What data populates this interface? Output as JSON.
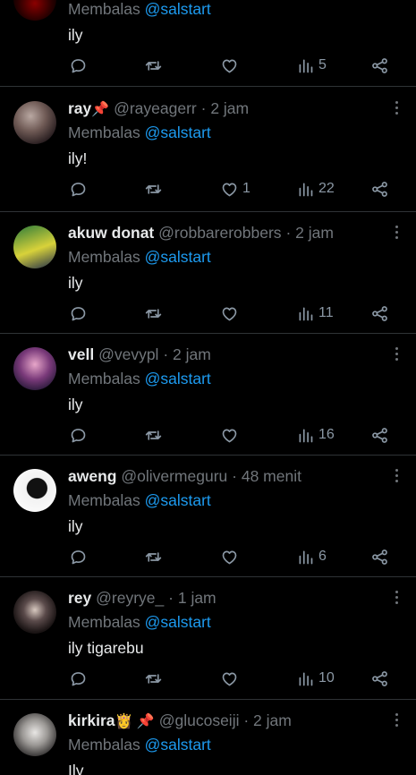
{
  "reply_prefix": "Membalas",
  "mention": "@salstart",
  "tweets": [
    {
      "name": "",
      "handle": "",
      "time": "",
      "text": "ily",
      "likes": "",
      "views": "5"
    },
    {
      "name": "ray",
      "name_emoji": "📌",
      "handle": "@rayeagerr",
      "time": "· 2 jam",
      "text": "ily!",
      "likes": "1",
      "views": "22"
    },
    {
      "name": "akuw donat",
      "handle": "@robbarerobbers",
      "time": "· 2 jam",
      "text": "ily",
      "likes": "",
      "views": "11"
    },
    {
      "name": "vell",
      "handle": "@vevypl",
      "time": "· 2 jam",
      "text": "ily",
      "likes": "",
      "views": "16"
    },
    {
      "name": "aweng",
      "handle": "@olivermeguru",
      "time": "· 48 menit",
      "text": "ily",
      "likes": "",
      "views": "6"
    },
    {
      "name": "rey",
      "handle": "@reyrye_",
      "time": "· 1 jam",
      "text": "ily tigarebu",
      "likes": "",
      "views": "10"
    },
    {
      "name": "kirkira",
      "name_emoji": "👸 📌",
      "handle": "@glucoseiji",
      "time": "· 2 jam",
      "text": "Ily",
      "likes": "",
      "views": ""
    }
  ],
  "colors": {
    "background": "#000000",
    "mention": "#1d9bf0",
    "muted": "#71767b",
    "divider": "#2f3336"
  },
  "icons": [
    "reply-icon",
    "retweet-icon",
    "like-icon",
    "views-icon",
    "share-icon",
    "more-icon"
  ]
}
